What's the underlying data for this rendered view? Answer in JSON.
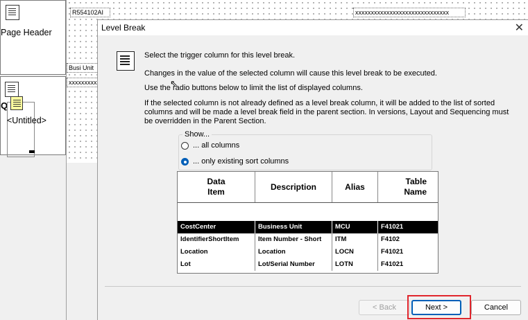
{
  "background": {
    "page_header_label": "Page Header",
    "untitled_label": "<Untitled>",
    "report_id": "R554102AI",
    "pattern_top": "xxxxxxxxxxxxxxxxxxxxxxxxxxxxxx",
    "busi_unit_label": "Busi Unit",
    "pattern_field": "xxxxxxxxxxxxxxxx",
    "q_label": "Q"
  },
  "dialog": {
    "title": "Level Break",
    "close_glyph": "✕",
    "line1": "Select the trigger column for this level break.",
    "line2": "Changes in the value of the selected column will cause this level break to be executed.",
    "line3": "Use the radio buttons below to limit the list of displayed columns.",
    "line4": "If the selected column is not already defined as a level break column, it will be added to the list of sorted columns and will be made a level break field in the parent section.  In versions, Layout and Sequencing must be overridden in the Parent Section.",
    "show_group": {
      "legend": "Show...",
      "options": [
        {
          "label": "... all columns",
          "selected": false
        },
        {
          "label": "... only existing sort columns",
          "selected": true
        }
      ]
    },
    "grid": {
      "headers": [
        "Data Item",
        "Description",
        "Alias",
        "Table Name"
      ],
      "rows": [
        [
          "CostCenter",
          "Business Unit",
          "MCU",
          "F41021"
        ],
        [
          "IdentifierShortItem",
          "Item Number - Short",
          "ITM",
          "F4102"
        ],
        [
          "Location",
          "Location",
          "LOCN",
          "F41021"
        ],
        [
          "Lot",
          "Lot/Serial Number",
          "LOTN",
          "F41021"
        ]
      ],
      "selected_row": 0
    },
    "buttons": {
      "back": "< Back",
      "next": "Next >",
      "cancel": "Cancel"
    }
  },
  "colors": {
    "accent": "#005fb8",
    "highlight": "#e0252c",
    "selected_row_bg": "#000000"
  }
}
